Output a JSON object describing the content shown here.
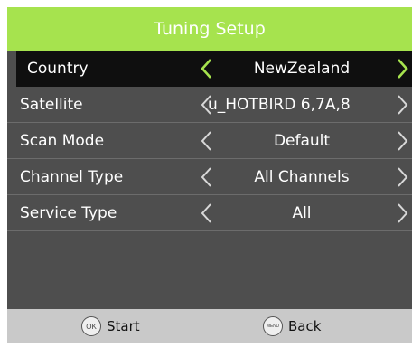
{
  "title": "Tuning Setup",
  "colors": {
    "accent": "#a6e34e",
    "panel": "#4e4e4e",
    "selected_row": "#0f0f0f",
    "footer": "#c9c9c9",
    "selected_chevron": "#a6e34e",
    "chevron": "#d8d8d8"
  },
  "rows": [
    {
      "label": "Country",
      "value": "NewZealand",
      "selected": true
    },
    {
      "label": "Satellite",
      "value": "u_HOTBIRD 6,7A,8",
      "selected": false
    },
    {
      "label": "Scan Mode",
      "value": "Default",
      "selected": false
    },
    {
      "label": "Channel Type",
      "value": "All Channels",
      "selected": false
    },
    {
      "label": "Service Type",
      "value": "All",
      "selected": false
    }
  ],
  "footer": {
    "start": {
      "key": "OK",
      "label": "Start",
      "icon": "ok-key-icon"
    },
    "back": {
      "key": "MENU",
      "label": "Back",
      "icon": "menu-key-icon"
    }
  }
}
